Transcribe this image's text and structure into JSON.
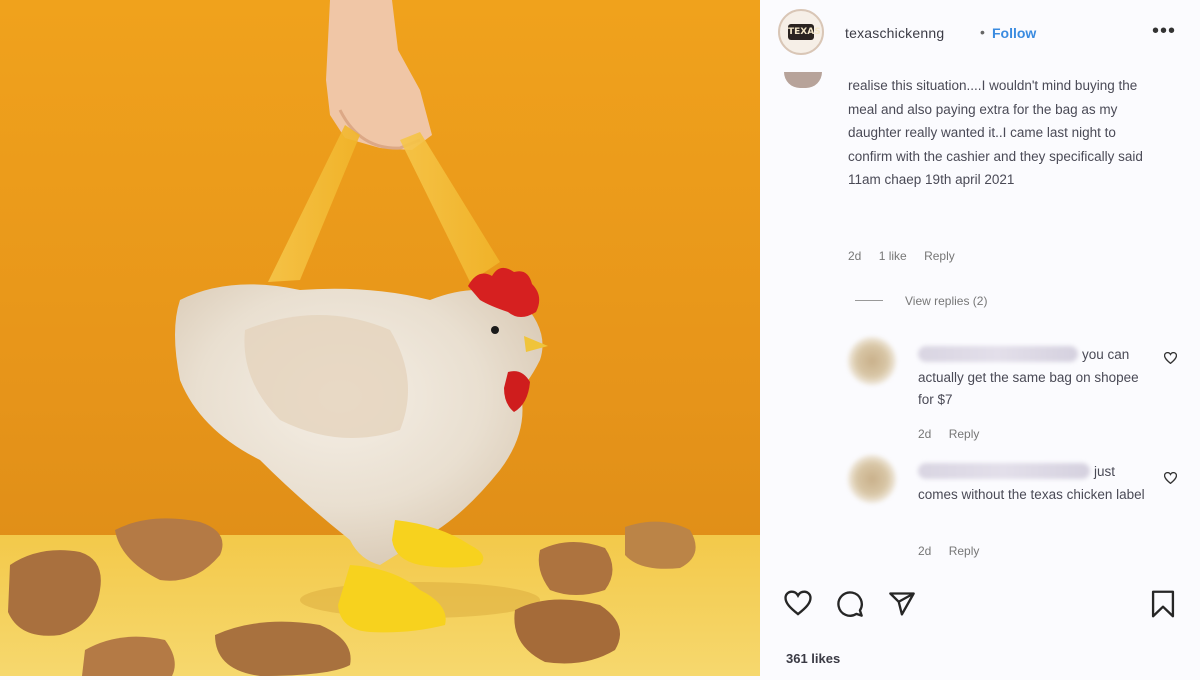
{
  "post": {
    "username": "texaschickenng",
    "separator": "•",
    "follow_label": "Follow",
    "more_label": "•••",
    "avatar_text": "TEXAS"
  },
  "caption": {
    "text": "realise this situation....I wouldn't mind buying the meal and also paying extra for the bag as my daughter really wanted it..I came last night to confirm with the cashier and they specifically said 11am chaep 19th april 2021",
    "age": "2d",
    "likes": "1 like",
    "reply_label": "Reply"
  },
  "replies_toggle": "View replies (2)",
  "comments": [
    {
      "text": "you can actually get the same bag on shopee for $7",
      "age": "2d",
      "reply_label": "Reply"
    },
    {
      "text": "just comes without the texas chicken label",
      "age": "2d",
      "reply_label": "Reply"
    }
  ],
  "footer": {
    "likes": "361 likes"
  },
  "icons": {
    "like": "heart-icon",
    "comment": "comment-icon",
    "share": "send-icon",
    "save": "bookmark-icon",
    "comment_like": "heart-outline-icon"
  },
  "colors": {
    "background_orange": "#e9981b",
    "follow_blue": "#3a8be0",
    "comb_red": "#d62020",
    "feet_yellow": "#f7d21e"
  }
}
